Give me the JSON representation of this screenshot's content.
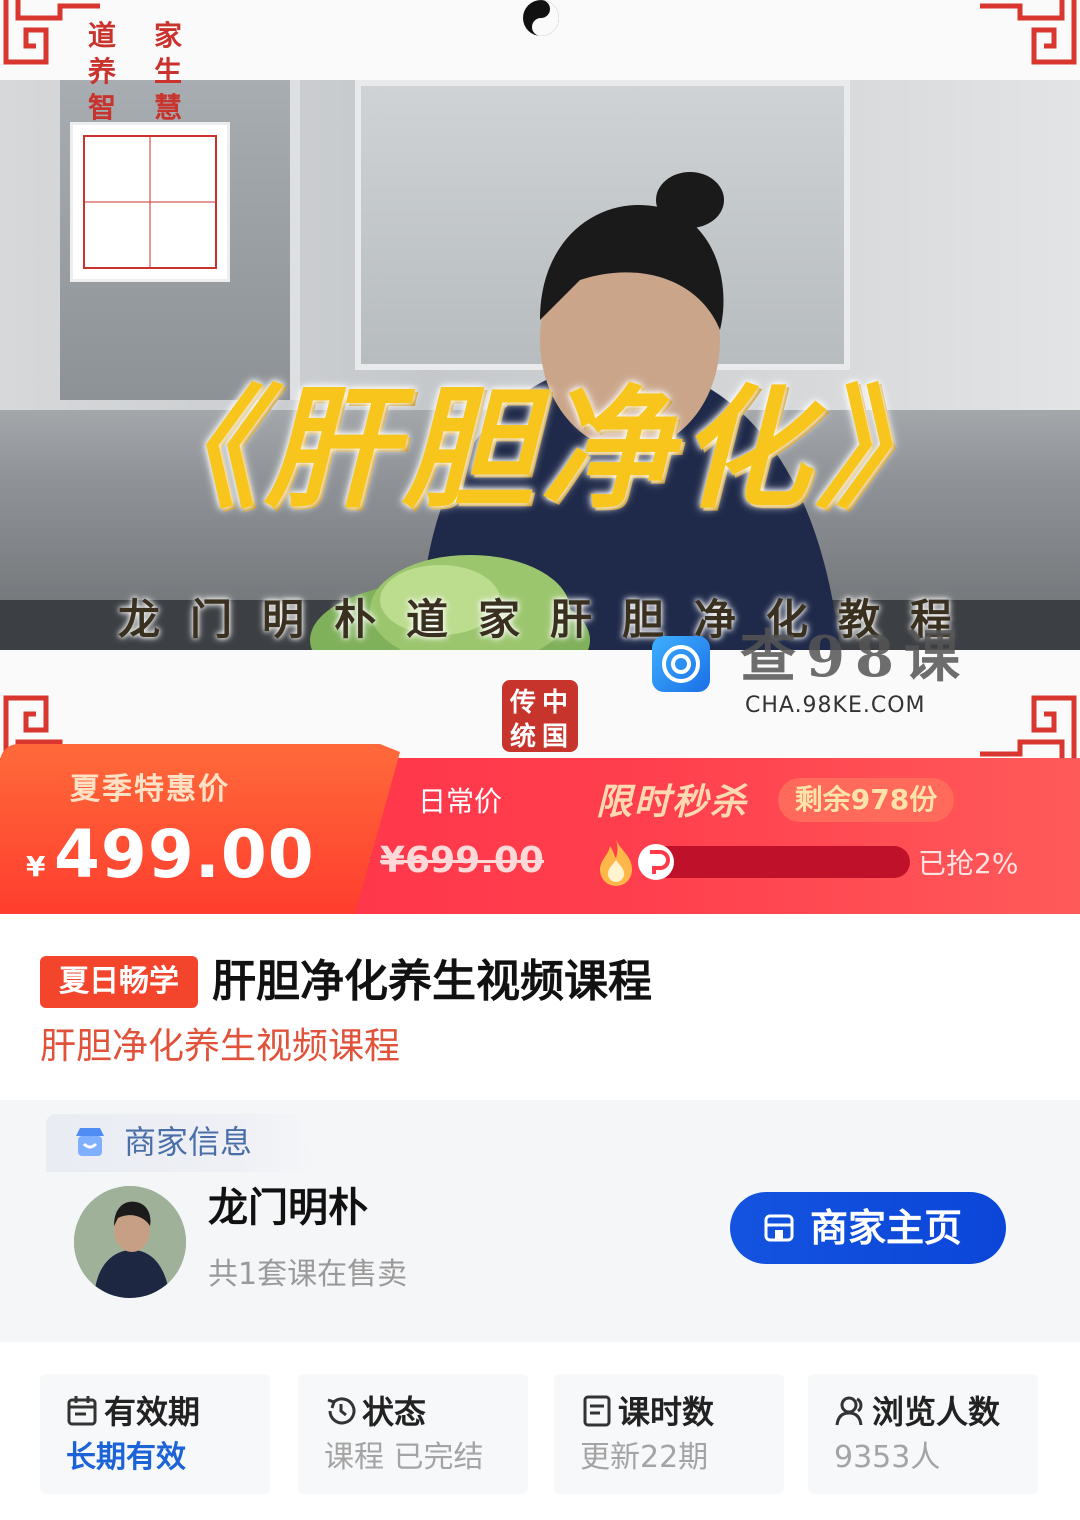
{
  "banner": {
    "main_title": "《肝胆净化》",
    "sub_title": "龙门明朴道家肝胆净化教程",
    "seal_left": [
      "道",
      "养",
      "智"
    ],
    "seal_right": [
      "家",
      "生",
      "慧"
    ],
    "stamp_chars": [
      "传",
      "中",
      "统",
      "国"
    ],
    "watermark_text": "查98课",
    "watermark_url": "CHA.98KE.COM"
  },
  "price": {
    "promo_label": "夏季特惠价",
    "currency": "¥",
    "current_price": "499.00",
    "daily_label": "日常价",
    "daily_price": "¥699.00",
    "flash_sale_label": "限时秒杀",
    "remaining": "剩余978份",
    "progress_fraction": 0.02,
    "grabbed": "已抢2%"
  },
  "course": {
    "promo_tag": "夏日畅学",
    "title": "肝胆净化养生视频课程",
    "subtitle": "肝胆净化养生视频课程"
  },
  "merchant": {
    "section_label": "商家信息",
    "name": "龙门明朴",
    "course_count": "共1套课在售卖",
    "home_button": "商家主页"
  },
  "stats": [
    {
      "label": "有效期",
      "value": "长期有效",
      "icon": "calendar-icon"
    },
    {
      "label": "状态",
      "value": "课程 已完结",
      "icon": "history-icon"
    },
    {
      "label": "课时数",
      "value": "更新22期",
      "icon": "document-icon"
    },
    {
      "label": "浏览人数",
      "value": "9353人",
      "icon": "user-icon"
    }
  ],
  "colors": {
    "accent_red": "#ff2d48",
    "price_orange": "#ff5a30",
    "button_blue": "#1453e0",
    "subtitle_red": "#e0523a",
    "title_gold": "#f7c51c"
  }
}
